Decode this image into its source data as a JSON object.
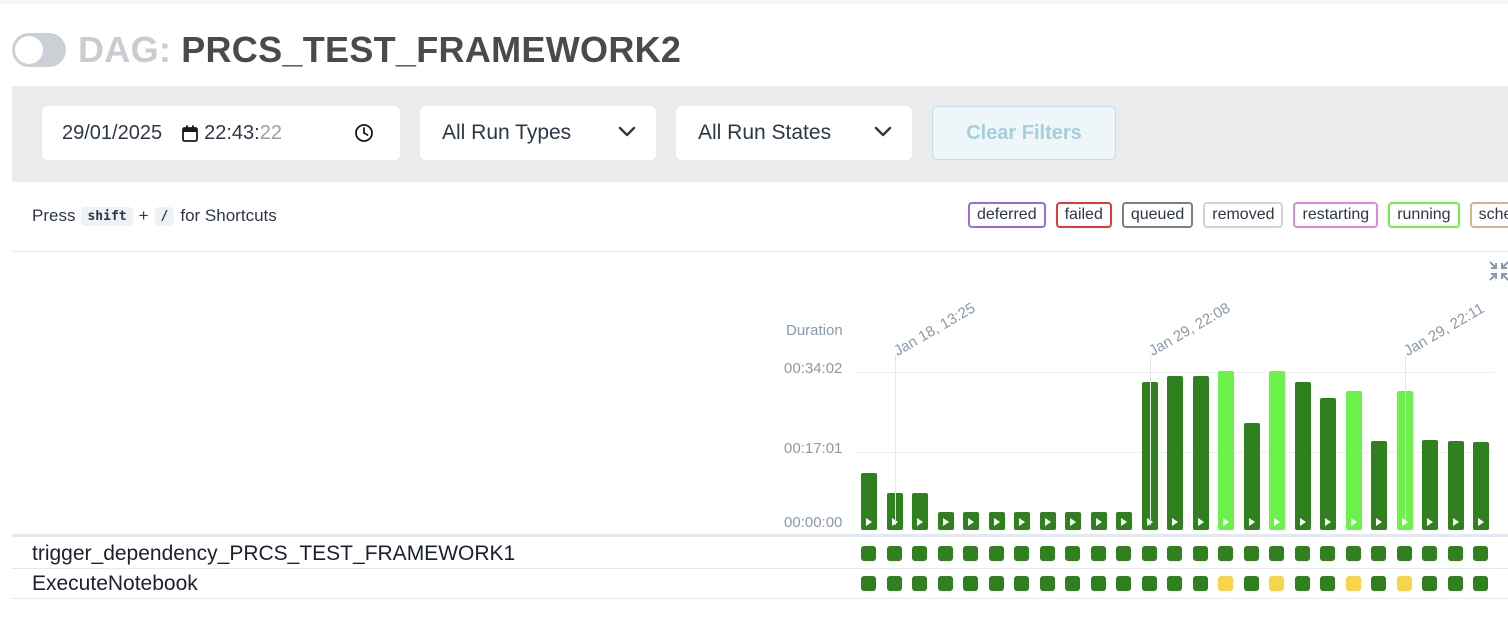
{
  "header": {
    "toggle_on": false,
    "title_prefix": "DAG:",
    "dag_id": "PRCS_TEST_FRAMEWORK2"
  },
  "filters": {
    "date_main": "29/01/2025",
    "time_main": "22:43:",
    "time_seconds": "22",
    "run_type": "All Run Types",
    "run_state": "All Run States",
    "clear_label": "Clear Filters"
  },
  "shortcuts": {
    "press": "Press",
    "key1": "shift",
    "plus": "+",
    "key2": "/",
    "suffix": "for Shortcuts"
  },
  "legend": [
    {
      "label": "deferred",
      "color": "#9b6cd6"
    },
    {
      "label": "failed",
      "color": "#e53935"
    },
    {
      "label": "queued",
      "color": "#808080"
    },
    {
      "label": "removed",
      "color": "#d3d3d3"
    },
    {
      "label": "restarting",
      "color": "#e088e0"
    },
    {
      "label": "running",
      "color": "#6cf24a"
    },
    {
      "label": "scheduled",
      "color": "#d2b48c"
    }
  ],
  "chart": {
    "duration_label": "Duration",
    "y_ticks": [
      "00:34:02",
      "00:17:01",
      "00:00:00"
    ],
    "x_labels": [
      {
        "text": "Jan 18, 13:25",
        "index": 1
      },
      {
        "text": "Jan 29, 22:08",
        "index": 11
      },
      {
        "text": "Jan 29, 22:11",
        "index": 21
      }
    ],
    "colors": {
      "success": "#31801f",
      "running": "#6cf24a",
      "queued_cell": "#f8d44a"
    }
  },
  "chart_data": {
    "type": "bar",
    "ylabel": "Duration",
    "y_max_seconds": 2042,
    "values_seconds": [
      730,
      470,
      470,
      230,
      230,
      230,
      230,
      230,
      230,
      230,
      230,
      1890,
      1960,
      1960,
      2030,
      1370,
      2030,
      1890,
      1690,
      1780,
      1130,
      1780,
      1150,
      1130,
      1120
    ],
    "states": [
      "success",
      "success",
      "success",
      "success",
      "success",
      "success",
      "success",
      "success",
      "success",
      "success",
      "success",
      "success",
      "success",
      "success",
      "running",
      "success",
      "running",
      "success",
      "success",
      "running",
      "success",
      "running",
      "success",
      "success",
      "success"
    ]
  },
  "tasks": [
    {
      "name": "trigger_dependency_PRCS_TEST_FRAMEWORK1",
      "cells": [
        "success",
        "success",
        "success",
        "success",
        "success",
        "success",
        "success",
        "success",
        "success",
        "success",
        "success",
        "success",
        "success",
        "success",
        "success",
        "success",
        "success",
        "success",
        "success",
        "success",
        "success",
        "success",
        "success",
        "success",
        "success"
      ]
    },
    {
      "name": "ExecuteNotebook",
      "cells": [
        "success",
        "success",
        "success",
        "success",
        "success",
        "success",
        "success",
        "success",
        "success",
        "success",
        "success",
        "success",
        "success",
        "success",
        "queued",
        "success",
        "queued",
        "success",
        "success",
        "queued",
        "success",
        "queued",
        "success",
        "success",
        "success"
      ]
    }
  ]
}
